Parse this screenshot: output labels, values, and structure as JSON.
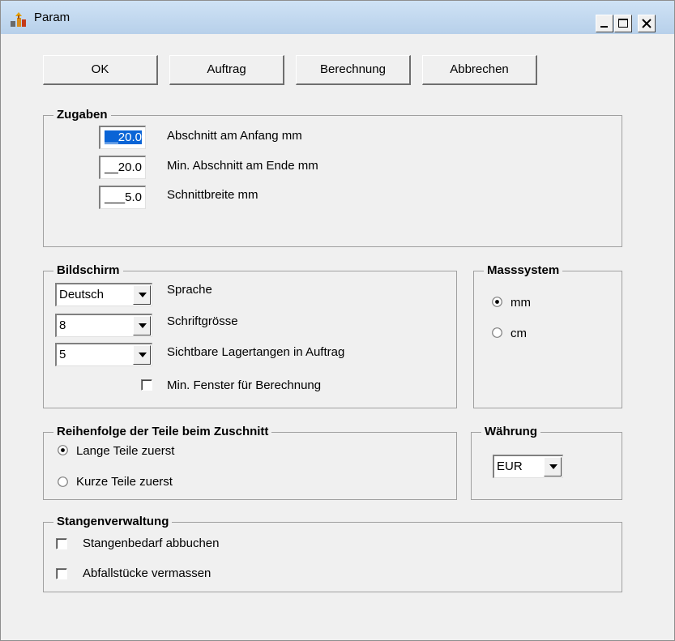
{
  "window": {
    "title": "Param",
    "app_icon": "app-icon",
    "controls": [
      "minimize-icon",
      "maximize-icon",
      "close-icon"
    ]
  },
  "buttons": {
    "ok": "OK",
    "auftrag": "Auftrag",
    "berechnung": "Berechnung",
    "abbrechen": "Abbrechen"
  },
  "zugaben": {
    "title": "Zugaben",
    "fields": [
      {
        "value": "__20.0",
        "label": "Abschnitt am Anfang mm",
        "selected": true
      },
      {
        "value": "__20.0",
        "label": "Min. Abschnitt am Ende mm",
        "selected": false
      },
      {
        "value": "___5.0",
        "label": "Schnittbreite mm",
        "selected": false
      }
    ]
  },
  "bildschirm": {
    "title": "Bildschirm",
    "combos": [
      {
        "value": "Deutsch",
        "label": "Sprache"
      },
      {
        "value": "8",
        "label": "Schriftgrösse"
      },
      {
        "value": "5",
        "label": "Sichtbare Lagertangen in Auftrag"
      }
    ],
    "checkbox": {
      "label": "Min. Fenster für Berechnung",
      "checked": false
    }
  },
  "masssystem": {
    "title": "Masssystem",
    "options": [
      {
        "label": "mm",
        "checked": true
      },
      {
        "label": "cm",
        "checked": false
      }
    ]
  },
  "reihenfolge": {
    "title": "Reihenfolge der Teile beim Zuschnitt",
    "options": [
      {
        "label": "Lange Teile zuerst",
        "checked": true
      },
      {
        "label": "Kurze Teile zuerst",
        "checked": false
      }
    ]
  },
  "waehrung": {
    "title": "Währung",
    "value": "EUR"
  },
  "stangenverwaltung": {
    "title": "Stangenverwaltung",
    "checkboxes": [
      {
        "label": "Stangenbedarf abbuchen",
        "checked": false
      },
      {
        "label": "Abfallstücke vermassen",
        "checked": false
      }
    ]
  }
}
